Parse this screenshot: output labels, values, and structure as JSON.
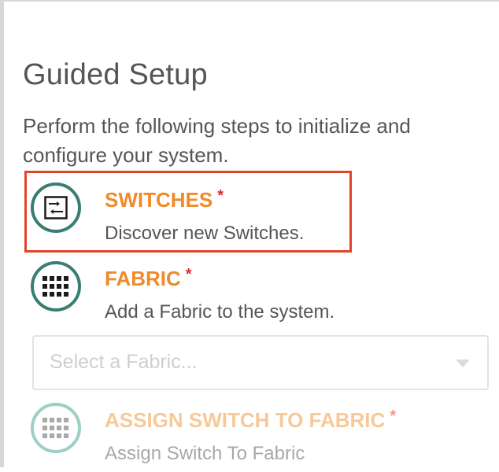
{
  "page": {
    "title": "Guided Setup",
    "intro": "Perform the following steps to initialize and configure your system."
  },
  "steps": [
    {
      "label": "SWITCHES",
      "required": "*",
      "description": "Discover new Switches.",
      "icon": "switch-config-icon",
      "state": "active"
    },
    {
      "label": "FABRIC",
      "required": "*",
      "description": "Add a Fabric to the system.",
      "icon": "grid-icon",
      "state": "enabled"
    },
    {
      "label": "ASSIGN SWITCH TO FABRIC",
      "required": "*",
      "description": "Assign Switch To Fabric",
      "icon": "grid-icon",
      "state": "disabled"
    }
  ],
  "fabric_select": {
    "placeholder": "Select a Fabric..."
  },
  "colors": {
    "step_label": "#f08a2a",
    "required_marker": "#d0312d",
    "icon_ring": "#3a7d72",
    "highlight_border": "#e2432a"
  }
}
